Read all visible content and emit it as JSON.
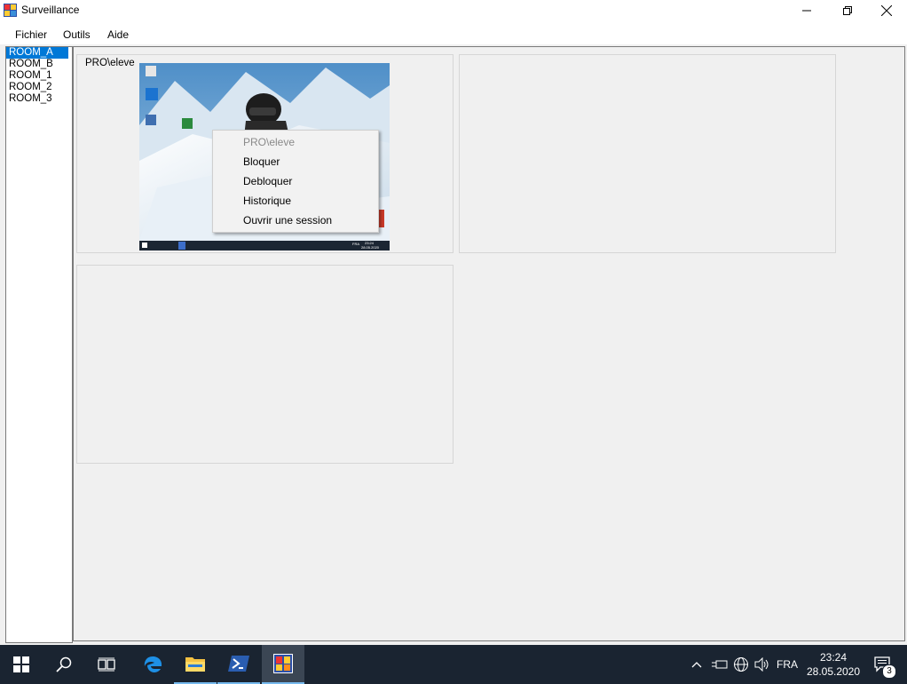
{
  "window": {
    "title": "Surveillance",
    "controls": {
      "minimize": "minimize",
      "restore": "restore",
      "close": "close"
    }
  },
  "menu": {
    "items": [
      "Fichier",
      "Outils",
      "Aide"
    ]
  },
  "rooms": {
    "items": [
      "ROOM_A",
      "ROOM_B",
      "ROOM_1",
      "ROOM_2",
      "ROOM_3"
    ],
    "selected": "ROOM_A"
  },
  "panels": [
    {
      "label": "PRO\\eleve",
      "has_screen": true
    },
    {
      "label": "",
      "has_screen": false
    },
    {
      "label": "",
      "has_screen": false
    }
  ],
  "thumbnail_taskbar": {
    "time": "23:24",
    "date": "28.05.2020",
    "lang": "FRA"
  },
  "context_menu": {
    "header": "PRO\\eleve",
    "items": [
      "Bloquer",
      "Debloquer",
      "Historique",
      "Ouvrir une session"
    ]
  },
  "taskbar": {
    "icons": [
      "windows-start-icon",
      "search-icon",
      "task-view-icon",
      "edge-icon",
      "file-explorer-icon",
      "powershell-icon",
      "surveillance-app-icon"
    ],
    "active_app": "surveillance-app-icon",
    "lang": "FRA",
    "time": "23:24",
    "date": "28.05.2020",
    "notification_count": "3"
  },
  "colors": {
    "accent": "#0078d7",
    "taskbar_bg": "#1a2431",
    "client_bg": "#f0f0f0"
  }
}
